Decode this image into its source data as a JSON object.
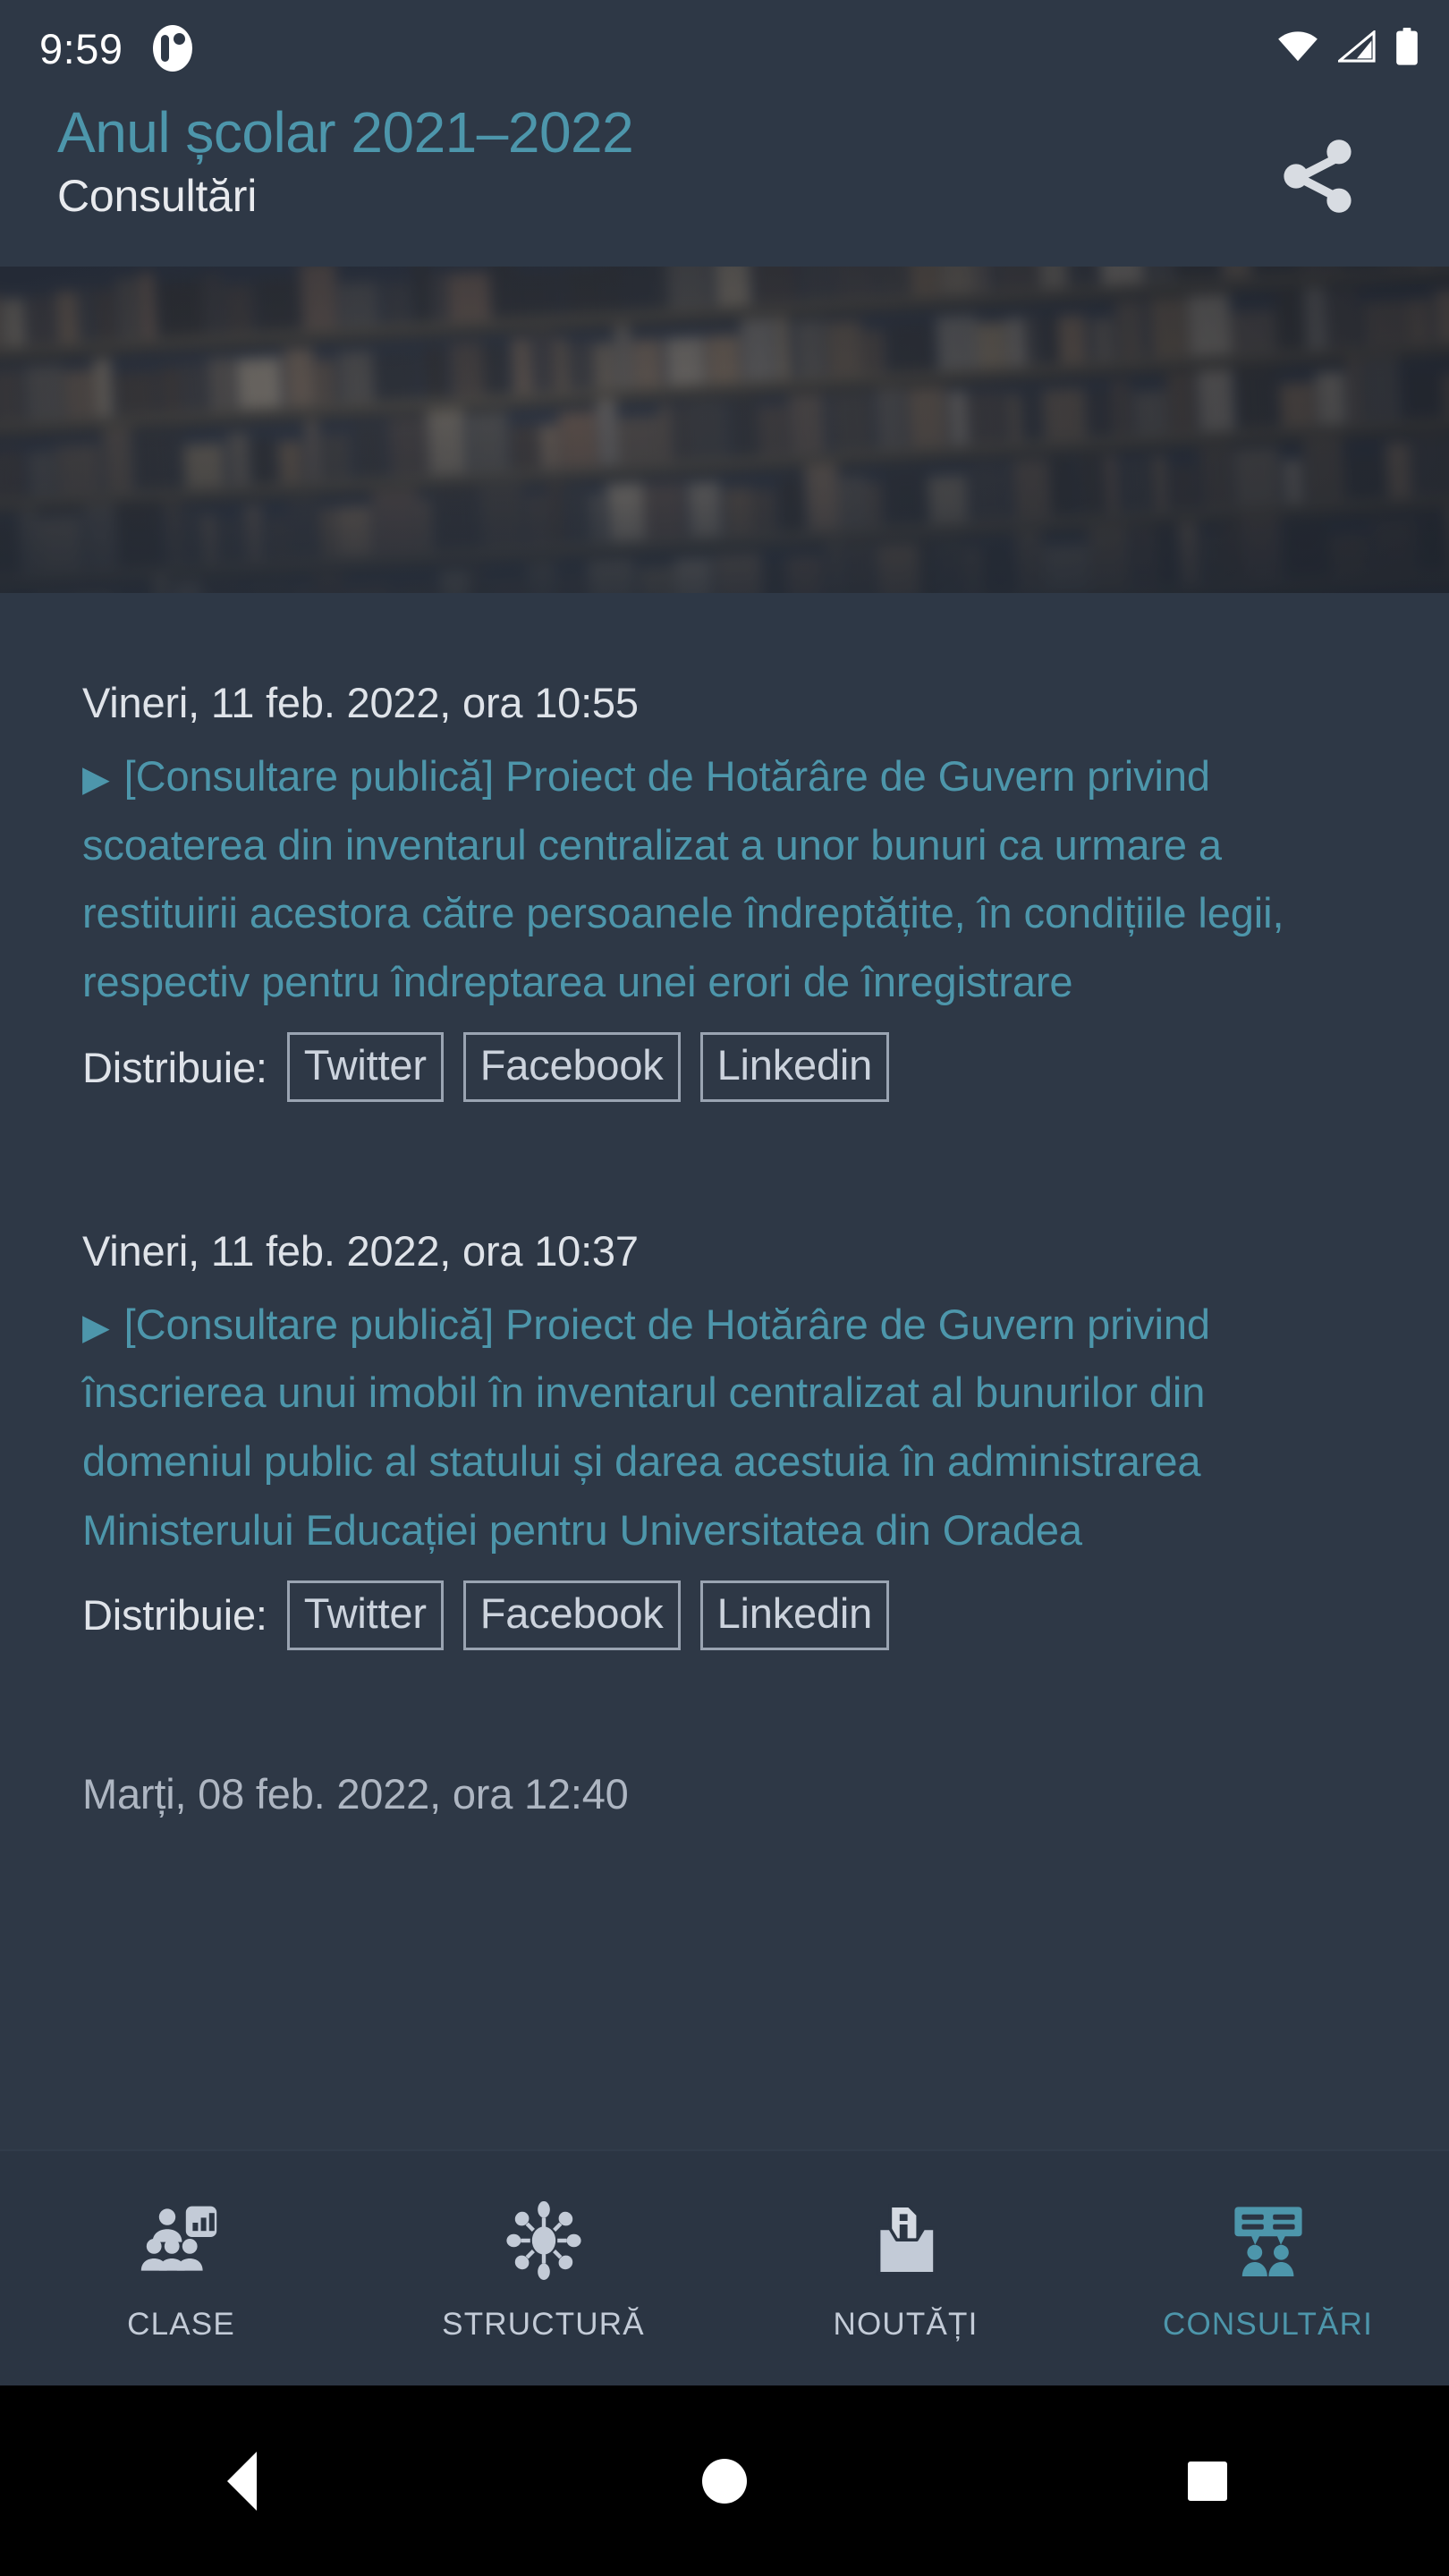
{
  "status_bar": {
    "clock": "9:59",
    "app_icon": "notification-app-icon",
    "icons": [
      "wifi-icon",
      "cellular-signal-icon",
      "battery-icon"
    ]
  },
  "app_bar": {
    "title": "Anul școlar 2021–2022",
    "subtitle": "Consultări",
    "share_icon": "share-icon",
    "title_color": "#4d96ab"
  },
  "hero": {
    "alt": "library-bookshelf-photo"
  },
  "entries": [
    {
      "date": "Vineri, 11 feb. 2022, ora 10:55",
      "bullet": "▶",
      "link": "[Consultare publică] Proiect de Hotărâre de Guvern privind scoaterea din inventarul centralizat a unor bunuri ca urmare a restituirii acestora către persoanele îndreptățite, în condițiile legii, respectiv pentru îndreptarea unei erori de înregistrare",
      "share_label": "Distribuie:",
      "share_buttons": [
        "Twitter",
        "Facebook",
        "Linkedin"
      ]
    },
    {
      "date": "Vineri, 11 feb. 2022, ora 10:37",
      "bullet": "▶",
      "link": "[Consultare publică] Proiect de Hotărâre de Guvern privind înscrierea unui imobil în inventarul centralizat al bunurilor din domeniul public al statului și darea acestuia în administrarea Ministerului Educației pentru Universitatea din Oradea",
      "share_label": "Distribuie:",
      "share_buttons": [
        "Twitter",
        "Facebook",
        "Linkedin"
      ]
    }
  ],
  "entry_partial": {
    "date": "Marți, 08 feb. 2022, ora 12:40"
  },
  "bottom_nav": {
    "active_color": "#4d96ab",
    "inactive_color": "#c3cbd7",
    "items": [
      {
        "label": "CLASE",
        "icon": "classes-people-chart-icon",
        "active": false
      },
      {
        "label": "STRUCTURĂ",
        "icon": "structure-network-icon",
        "active": false
      },
      {
        "label": "NOUTĂȚI",
        "icon": "news-info-tray-icon",
        "active": false
      },
      {
        "label": "CONSULTĂRI",
        "icon": "consultations-people-chat-icon",
        "active": true
      }
    ]
  },
  "android_nav": {
    "back": "back-triangle-icon",
    "home": "home-circle-icon",
    "recents": "recents-square-icon"
  }
}
